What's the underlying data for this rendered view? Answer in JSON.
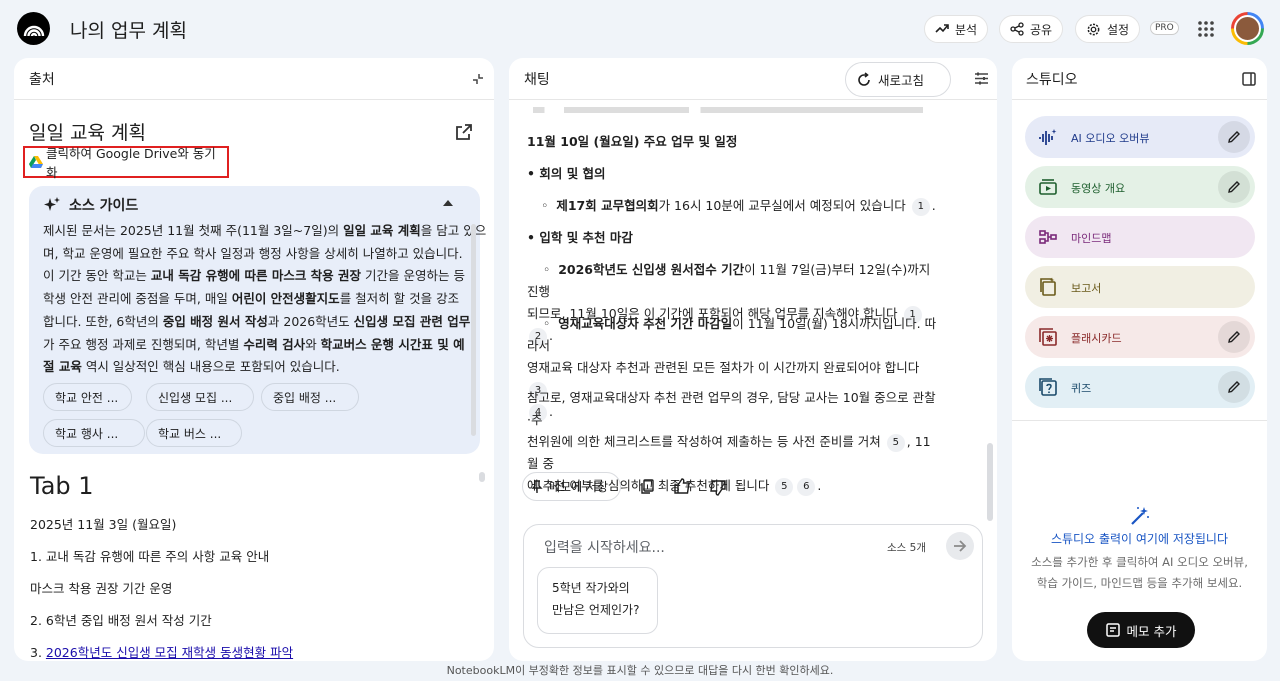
{
  "app": {
    "title": "나의 업무 계획",
    "pro_badge": "PRO"
  },
  "header_buttons": {
    "analytics": "분석",
    "share": "공유",
    "settings": "설정"
  },
  "sources_panel": {
    "title": "출처",
    "source_title": "일일 교육 계획",
    "sync_label": "클릭하여 Google Drive와 동기화",
    "guide_title": "소스 가이드",
    "guide_lines": [
      [
        {
          "t": "제시된 문서는 2025년 11월 첫째 주(11월 3일~7일)의 ",
          "b": false
        },
        {
          "t": "일일 교육 계획",
          "b": true
        },
        {
          "t": "을 담고 있으",
          "b": false
        }
      ],
      [
        {
          "t": "며, 학교 운영에 필요한 주요 학사 일정과 행정 사항을 상세히 나열하고 있습니다.",
          "b": false
        }
      ],
      [
        {
          "t": "이 기간 동안 학교는 ",
          "b": false
        },
        {
          "t": "교내 독감 유행에 따른 마스크 착용 권장",
          "b": true
        },
        {
          "t": " 기간을 운영하는 등",
          "b": false
        }
      ],
      [
        {
          "t": "학생 안전 관리에 중점을 두며, 매일 ",
          "b": false
        },
        {
          "t": "어린이 안전생활지도",
          "b": true
        },
        {
          "t": "를 철저히 할 것을 강조",
          "b": false
        }
      ],
      [
        {
          "t": "합니다. 또한, 6학년의 ",
          "b": false
        },
        {
          "t": "중입 배정 원서 작성",
          "b": true
        },
        {
          "t": "과 2026학년도 ",
          "b": false
        },
        {
          "t": "신입생 모집 관련 업무",
          "b": true
        }
      ],
      [
        {
          "t": "가 주요 행정 과제로 진행되며, 학년별 ",
          "b": false
        },
        {
          "t": "수리력 검사",
          "b": true
        },
        {
          "t": "와 ",
          "b": false
        },
        {
          "t": "학교버스 운행 시간표 및 예",
          "b": true
        }
      ],
      [
        {
          "t": "절 교육",
          "b": true
        },
        {
          "t": " 역시 일상적인 핵심 내용으로 포함되어 있습니다.",
          "b": false
        }
      ]
    ],
    "chips": [
      "학교 안전 ...",
      "신입생 모집 ...",
      "중입 배정 ...",
      "학교 행사 ...",
      "학교 버스 ..."
    ],
    "doc_heading": "Tab 1",
    "doc_lines": [
      "2025년 11월 3일 (월요일)",
      "1. 교내 독감 유행에 따른 주의 사항 교육 안내",
      "마스크 착용 권장 기간 운영",
      "2. 6학년 중입 배정 원서 작성 기간"
    ],
    "doc_link_prefix": "3. ",
    "doc_link": "2026학년도 신입생 모집 재학생 동생현황 파악"
  },
  "chat_panel": {
    "title": "채팅",
    "refresh_label": "새로고침",
    "heading": "11월 10일 (월요일) 주요 업무 및 일정",
    "section1": "• 회의 및 협의",
    "item1_bold": "제17회 교무협의회",
    "item1_rest": "가 16시 10분에 교무실에서 예정되어 있습니다",
    "item1_cites": [
      "1"
    ],
    "section2": "• 입학 및 추천 마감",
    "item2_bold": "2026학년도 신입생 원서접수 기간",
    "item2_rest1": "이 11월 7일(금)부터 12일(수)까지 진행",
    "item2_rest2": "되므로, 11월 10일은 이 기간에 포함되어 해당 업무를 지속해야 합니다",
    "item2_cites": [
      "1",
      "2"
    ],
    "item3_bold": "영재교육대상자 추천 기간 마감일",
    "item3_rest1": "이 11월 10일(월) 18시까지입니다. 따라서",
    "item3_rest2": "영재교육 대상자 추천과 관련된 모든 절차가 이 시간까지 완료되어야 합니다",
    "item3_cites": [
      "3",
      "4"
    ],
    "para_line1": "참고로, 영재교육대상자 추천 관련 업무의 경우, 담당 교사는 10월 중으로 관찰·추",
    "para_line2": "천위원에 의한 체크리스트를 작성하여 제출하는 등 사전 준비를 거쳐",
    "para_line2_tail": ", 11월 중",
    "para_line3": "에 추천 여부를 심의하고 최종 추천하게 됩니다",
    "para_cites_a": [
      "5"
    ],
    "para_cites_b": [
      "5",
      "6"
    ],
    "save_note": "메모에 저장",
    "input_placeholder": "입력을 시작하세요...",
    "source_count": "소스 5개",
    "suggestion": [
      "5학년 작가와의",
      "만남은 언제인가?"
    ]
  },
  "studio_panel": {
    "title": "스튜디오",
    "items": [
      {
        "label": "AI 오디오 오버뷰",
        "bg": "#e6eaf7",
        "color": "#1f3a8a"
      },
      {
        "label": "동영상 개요",
        "bg": "#e4f1e6",
        "color": "#1e5f2e"
      },
      {
        "label": "마인드맵",
        "bg": "#f1e7f2",
        "color": "#7a2a7a"
      },
      {
        "label": "보고서",
        "bg": "#f1efe3",
        "color": "#6a5a1a"
      },
      {
        "label": "플래시카드",
        "bg": "#f6e9e8",
        "color": "#8a2a2a"
      },
      {
        "label": "퀴즈",
        "bg": "#e2eff5",
        "color": "#1a4a6a"
      }
    ],
    "empty_title": "스튜디오 출력이 여기에 저장됩니다",
    "empty_desc1": "소스를 추가한 후 클릭하여 AI 오디오 오버뷰,",
    "empty_desc2": "학습 가이드, 마인드맵 등을 추가해 보세요.",
    "add_note": "메모 추가"
  },
  "footer": "NotebookLM이 부정확한 정보를 표시할 수 있으므로 대답을 다시 한번 확인하세요."
}
